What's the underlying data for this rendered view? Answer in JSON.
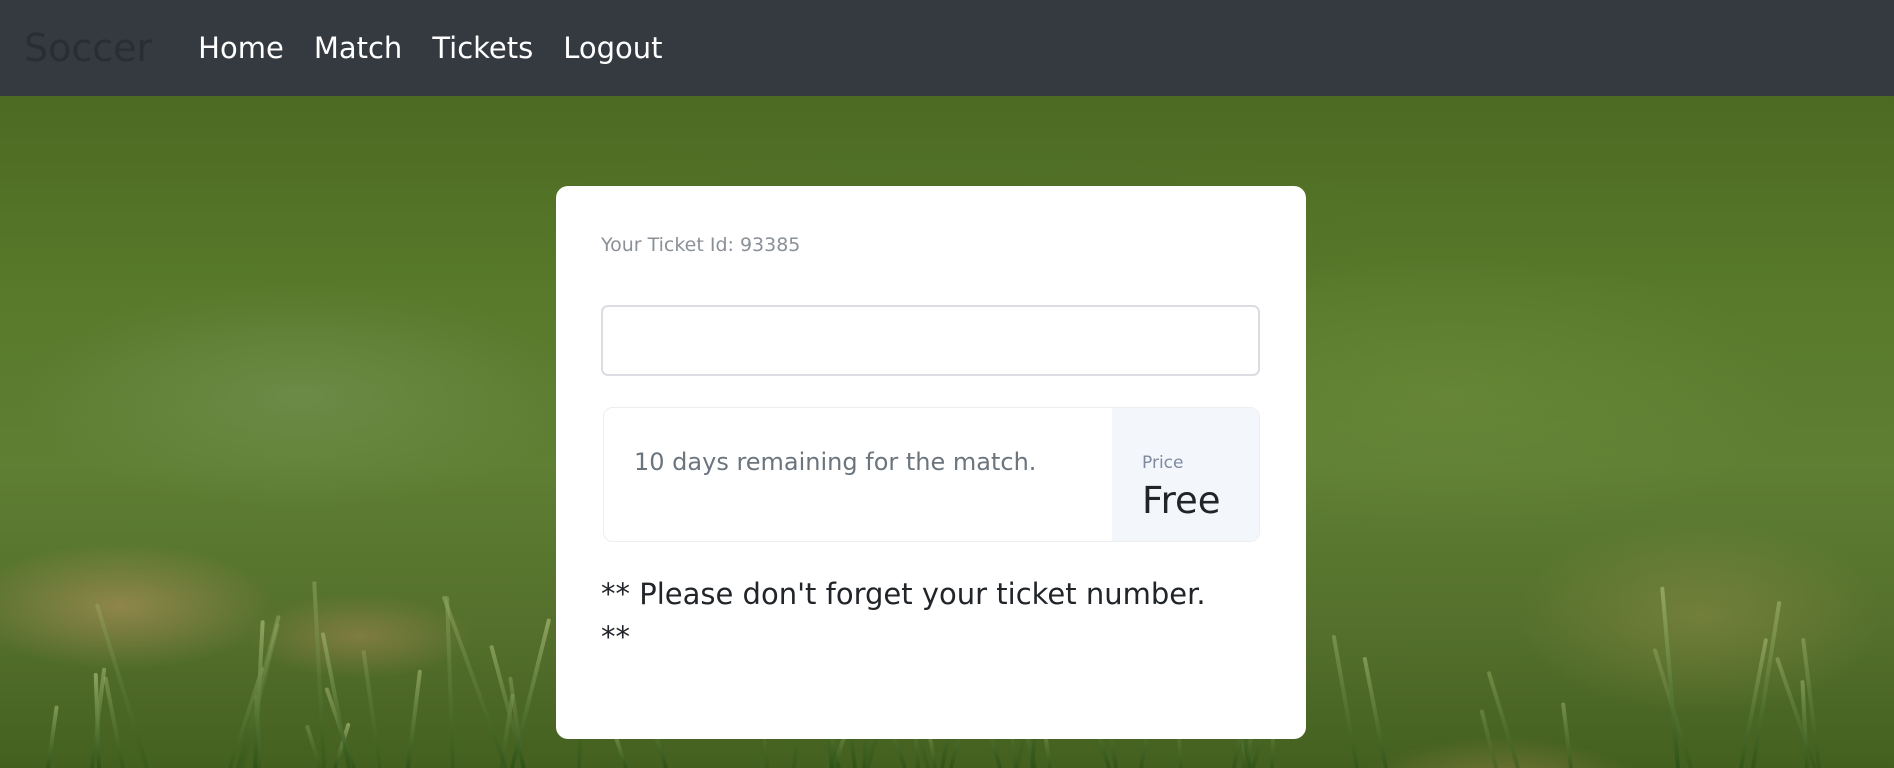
{
  "navbar": {
    "brand": "Soccer",
    "links": [
      {
        "label": "Home"
      },
      {
        "label": "Match"
      },
      {
        "label": "Tickets"
      },
      {
        "label": "Logout"
      }
    ],
    "background_color": "#343a40"
  },
  "ticket_card": {
    "ticket_id_text": "Your Ticket Id: 93385",
    "input": {
      "value": "",
      "placeholder": ""
    },
    "remaining_text": "10 days remaining for the match.",
    "price_label": "Price",
    "price_value": "Free",
    "note": "** Please don't forget your ticket number. **"
  },
  "background": {
    "image": "grass-field-photo"
  }
}
